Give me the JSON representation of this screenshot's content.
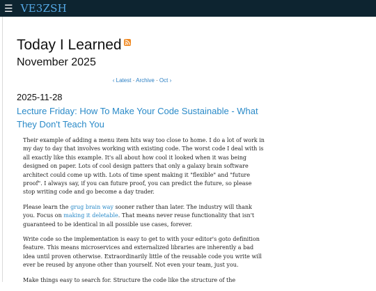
{
  "header": {
    "menu_icon": "☰",
    "site_title": "VE3ZSH"
  },
  "page": {
    "title": "Today I Learned",
    "month": "November 2025",
    "rss_icon": "rss-feed-icon"
  },
  "nav": {
    "latest": "‹ Latest",
    "sep1": " · ",
    "archive": "Archive",
    "sep2": " · ",
    "oct": "Oct ›"
  },
  "post": {
    "date": "2025-11-28",
    "title": "Lecture Friday: How To Make Your Code Sustainable - What They Don't Teach You",
    "p1": "Their example of adding a menu item hits way too close to home. I do a lot of work in my day to day that involves working with existing code. The worst code I deal with is all exactly like this example. It's all about how cool it looked when it was being designed on paper. Lots of cool design patters that only a galaxy brain software architect could come up with. Lots of time spent making it \"flexible\" and \"future proof\". I always say, if you can future proof, you can predict the future, so please stop writing code and go become a day trader.",
    "p2_a": "Please learn the ",
    "p2_link1": "grug brain way",
    "p2_b": " sooner rather than later. The industry will thank you. Focus on ",
    "p2_link2": "making it deletable",
    "p2_c": ". That means never reuse functionality that isn't guaranteed to be identical in all possible use cases, forever.",
    "p3": "Write code so the implementation is easy to get to with your editor's goto definition feature. This means microservices and externalized libraries are inherently a bad idea until proven otherwise. Extraordinarily little of the reusable code you write will ever be reused by anyone other than yourself. Not even your team, just you.",
    "p4": "Make things easy to search for. Structure the code like the structure of the"
  },
  "colors": {
    "topbar": "#0d2430",
    "site_title": "#56a9e6",
    "link": "#2a8ac8",
    "rss": "#f08a24"
  }
}
